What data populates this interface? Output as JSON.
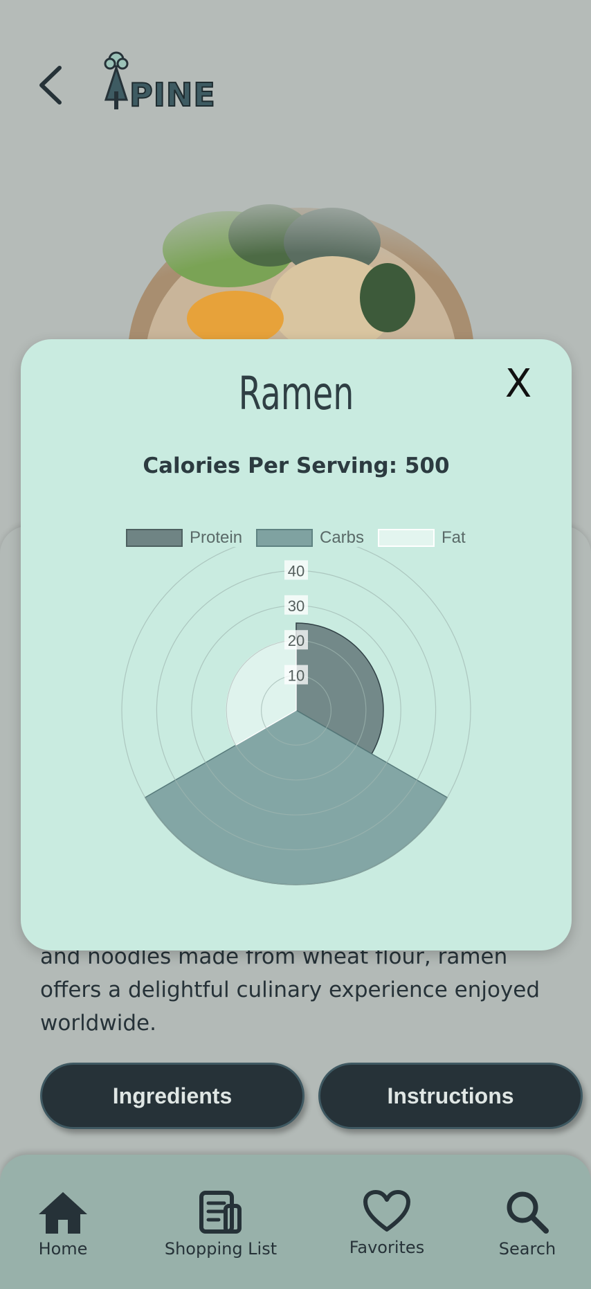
{
  "nav": {
    "back_label": "Back",
    "logo_text": "PINE"
  },
  "recipe": {
    "name": "Ramen",
    "calories_label": "Calories Per Serving: 500",
    "description": "and noodles made from wheat flour, ramen offers a delightful culinary experience enjoyed worldwide."
  },
  "modal": {
    "close_label": "X"
  },
  "buttons": {
    "ingredients": "Ingredients",
    "instructions": "Instructions"
  },
  "bottom_nav": [
    {
      "label": "Home",
      "icon": "home-icon"
    },
    {
      "label": "Shopping List",
      "icon": "shopping-list-icon"
    },
    {
      "label": "Favorites",
      "icon": "heart-icon"
    },
    {
      "label": "Search",
      "icon": "search-icon"
    }
  ],
  "colors": {
    "protein": "#6f8484",
    "carbs": "#7fa2a1",
    "fat": "#e3f5ef",
    "modal_bg": "#c9ebe0",
    "dark": "#263238"
  },
  "chart_data": {
    "type": "polarArea",
    "categories": [
      "Protein",
      "Carbs",
      "Fat"
    ],
    "values": [
      25,
      50,
      20
    ],
    "r_ticks": [
      10,
      20,
      30,
      40,
      50
    ],
    "r_range": [
      0,
      50
    ],
    "legend_position": "top",
    "grid": true
  }
}
